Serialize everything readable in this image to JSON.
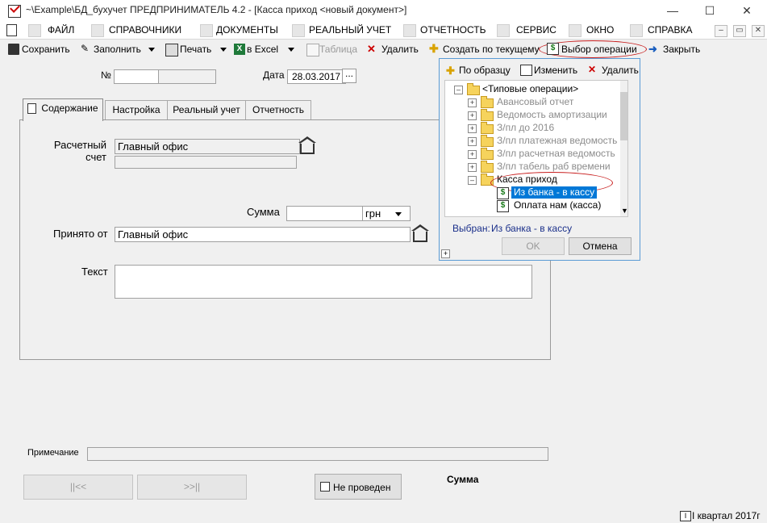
{
  "window": {
    "title": "~\\Example\\БД_бухучет  ПРЕДПРИНИМАТЕЛЬ 4.2 - [Касса приход <новый документ>]",
    "minimize": "—",
    "maximize": "☐",
    "close": "✕"
  },
  "menu": {
    "items": [
      "ФАЙЛ",
      "СПРАВОЧНИКИ",
      "ДОКУМЕНТЫ",
      "РЕАЛЬНЫЙ УЧЕТ",
      "ОТЧЕТНОСТЬ",
      "СЕРВИС",
      "ОКНО",
      "СПРАВКА"
    ],
    "mdi_controls": [
      "–",
      "▭",
      "✕"
    ]
  },
  "toolbar": {
    "save": "Сохранить",
    "fill": "Заполнить",
    "print": "Печать",
    "excel": "в Excel",
    "table": "Таблица",
    "delete": "Удалить",
    "create_from": "Создать по текущему",
    "choose_operation": "Выбор операции",
    "close": "Закрыть"
  },
  "header_fields": {
    "number_label": "№",
    "number_value": "",
    "date_label": "Дата",
    "date_value": "28.03.2017",
    "date_button": "..."
  },
  "tabs": [
    "Содержание",
    "Настройка",
    "Реальный учет",
    "Отчетность"
  ],
  "form": {
    "account_label": "Расчетный счет",
    "account_value": "Главный офис",
    "account_sub_value": "",
    "sum_label": "Сумма",
    "sum_value": "",
    "currency": "грн",
    "received_from_label": "Принято от",
    "received_from_value": "Главный офис",
    "text_label": "Текст",
    "text_value": ""
  },
  "footer": {
    "note_label": "Примечание",
    "note_value": "",
    "first_button": "||<<",
    "last_button": ">>||",
    "not_posted": "Не проведен",
    "sum_caption": "Сумма"
  },
  "popup": {
    "toolbar": {
      "by_sample": "По образцу",
      "edit": "Изменить",
      "delete": "Удалить"
    },
    "tree": {
      "root": "<Типовые операции>",
      "folders": [
        "Авансовый отчет",
        "Ведомость амортизации",
        "З/пл до 2016",
        "З/пл платежная ведомость",
        "З/пл расчетная ведомость",
        "З/пл табель раб времени"
      ],
      "open_folder": "Касса приход",
      "operations": [
        "Из банка - в кассу",
        "Оплата нам (касса)"
      ]
    },
    "selected_label": "Выбран:",
    "selected_value": "Из банка - в кассу",
    "ok": "OK",
    "cancel": "Отмена"
  },
  "status": {
    "period": "I квартал 2017г"
  },
  "colors": {
    "highlight": "#0078d7",
    "annotation_red": "#c81e1e",
    "popup_border": "#5a9bd5",
    "disabled_text": "#9a9a9a"
  }
}
